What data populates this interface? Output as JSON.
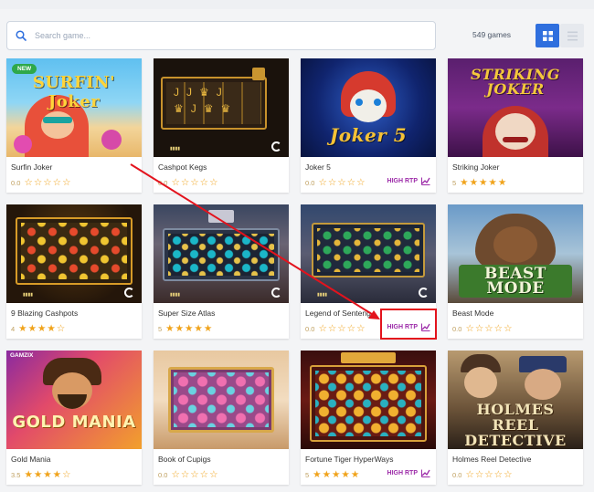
{
  "search": {
    "placeholder": "Search game..."
  },
  "games_count": "549 games",
  "view": {
    "grid_label": "grid-view",
    "list_label": "list-view"
  },
  "high_rtp_label": "HIGH RTP",
  "new_badge": "NEW",
  "colors": {
    "accent": "#2f6fde",
    "star": "#f0a31b",
    "rtp": "#9c2aa8",
    "highlight": "#e3131d"
  },
  "games": [
    {
      "name": "Surfin Joker",
      "rating": "0.0",
      "stars": 0,
      "high_rtp": false,
      "is_new": true,
      "art": "SURFIN' Joker"
    },
    {
      "name": "Cashpot Kegs",
      "rating": "0.0",
      "stars": 0,
      "high_rtp": false,
      "is_new": false,
      "art": ""
    },
    {
      "name": "Joker 5",
      "rating": "0.0",
      "stars": 0,
      "high_rtp": true,
      "is_new": false,
      "art": "Joker 5"
    },
    {
      "name": "Striking Joker",
      "rating": "5",
      "stars": 5,
      "high_rtp": false,
      "is_new": false,
      "art": "STRIKING JOKER"
    },
    {
      "name": "9 Blazing Cashpots",
      "rating": "4",
      "stars": 4,
      "high_rtp": false,
      "is_new": false,
      "art": ""
    },
    {
      "name": "Super Size Atlas",
      "rating": "5",
      "stars": 5,
      "high_rtp": false,
      "is_new": false,
      "art": ""
    },
    {
      "name": "Legend of Senteng",
      "rating": "0.0",
      "stars": 0,
      "high_rtp": true,
      "is_new": false,
      "art": ""
    },
    {
      "name": "Beast Mode",
      "rating": "0.0",
      "stars": 0,
      "high_rtp": false,
      "is_new": false,
      "art": "BEAST MODE"
    },
    {
      "name": "Gold Mania",
      "rating": "3.5",
      "stars": 3.5,
      "high_rtp": false,
      "is_new": false,
      "art": "GOLD MANIA"
    },
    {
      "name": "Book of Cupigs",
      "rating": "0.0",
      "stars": 0,
      "high_rtp": false,
      "is_new": false,
      "art": ""
    },
    {
      "name": "Fortune Tiger HyperWays",
      "rating": "5",
      "stars": 5,
      "high_rtp": true,
      "is_new": false,
      "art": ""
    },
    {
      "name": "Holmes Reel Detective",
      "rating": "0.0",
      "stars": 0,
      "high_rtp": false,
      "is_new": false,
      "art": "HOLMES REEL DETECTIVE"
    }
  ]
}
